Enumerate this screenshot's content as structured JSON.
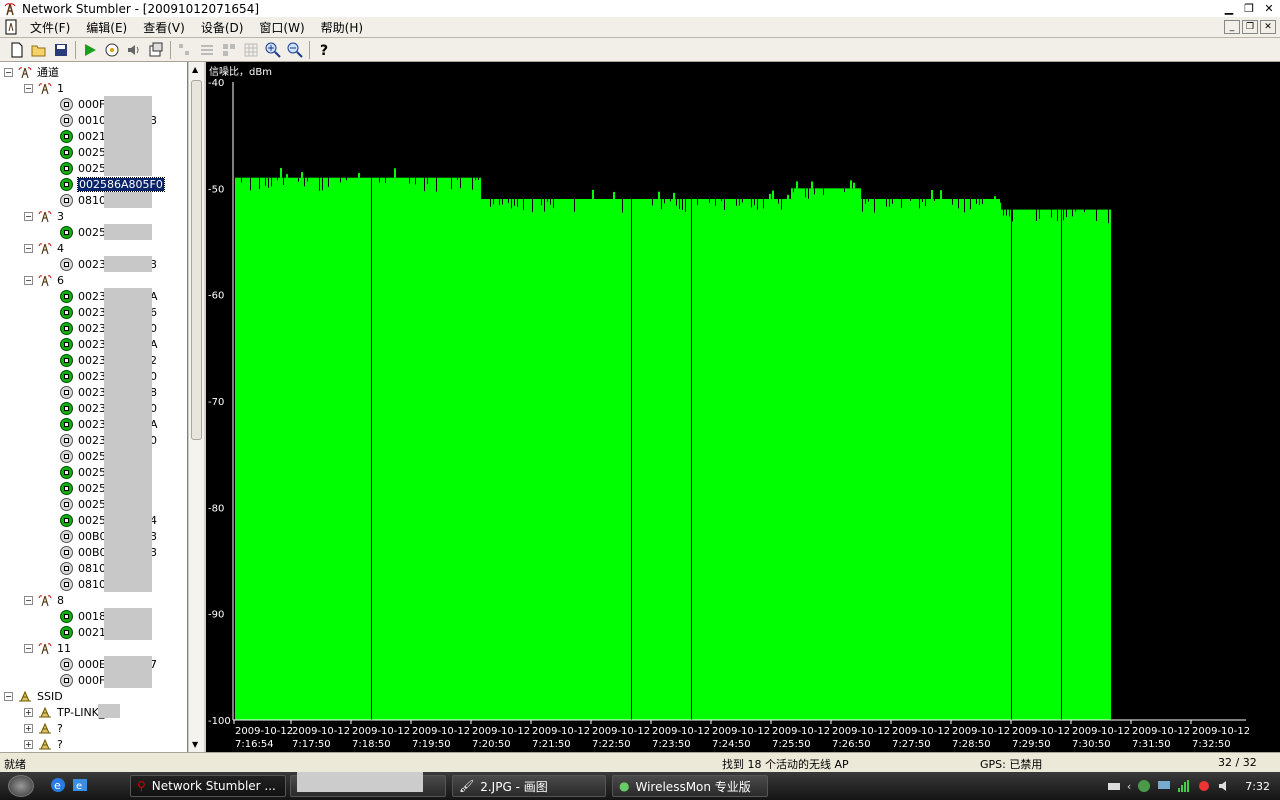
{
  "window": {
    "title": "Network Stumbler - [20091012071654]"
  },
  "menu": [
    "文件(F)",
    "编辑(E)",
    "查看(V)",
    "设备(D)",
    "窗口(W)",
    "帮助(H)"
  ],
  "tree": {
    "channels_label": "通道",
    "channels": [
      {
        "name": "1",
        "aps": [
          {
            "mac": "000F",
            "locked": true
          },
          {
            "mac": "0010",
            "locked": true,
            "suffix": "3"
          },
          {
            "mac": "0021",
            "locked": false
          },
          {
            "mac": "0025",
            "locked": false
          },
          {
            "mac": "0025",
            "locked": false
          },
          {
            "mac": "002586A805F0",
            "locked": false,
            "selected": true
          },
          {
            "mac": "0810",
            "locked": true
          }
        ]
      },
      {
        "name": "3",
        "aps": [
          {
            "mac": "0025",
            "locked": false
          }
        ]
      },
      {
        "name": "4",
        "aps": [
          {
            "mac": "0023",
            "locked": true,
            "suffix": "3"
          }
        ]
      },
      {
        "name": "6",
        "aps": [
          {
            "mac": "0023",
            "locked": false,
            "suffix": "A"
          },
          {
            "mac": "0023",
            "locked": false,
            "suffix": "6"
          },
          {
            "mac": "0023",
            "locked": false,
            "suffix": "0"
          },
          {
            "mac": "0023",
            "locked": false,
            "suffix": "A"
          },
          {
            "mac": "0023",
            "locked": false,
            "suffix": "2"
          },
          {
            "mac": "0023",
            "locked": false,
            "suffix": "0"
          },
          {
            "mac": "0023",
            "locked": true,
            "suffix": "8"
          },
          {
            "mac": "0023",
            "locked": false,
            "suffix": "0"
          },
          {
            "mac": "0023",
            "locked": false,
            "suffix": "A"
          },
          {
            "mac": "0023",
            "locked": true,
            "suffix": "0"
          },
          {
            "mac": "0025",
            "locked": true
          },
          {
            "mac": "0025",
            "locked": false
          },
          {
            "mac": "0025",
            "locked": false
          },
          {
            "mac": "0025",
            "locked": true
          },
          {
            "mac": "0025",
            "locked": false,
            "suffix": "4"
          },
          {
            "mac": "00B0",
            "locked": true,
            "suffix": "3"
          },
          {
            "mac": "00B0",
            "locked": true,
            "suffix": "3"
          },
          {
            "mac": "0810",
            "locked": true
          },
          {
            "mac": "0810",
            "locked": true
          }
        ]
      },
      {
        "name": "8",
        "aps": [
          {
            "mac": "0018",
            "locked": false
          },
          {
            "mac": "0021",
            "locked": false
          }
        ]
      },
      {
        "name": "11",
        "aps": [
          {
            "mac": "000E",
            "locked": true,
            "suffix": "7"
          },
          {
            "mac": "000F",
            "locked": true
          }
        ]
      }
    ],
    "ssid_label": "SSID",
    "ssids": [
      "TP-LINK_",
      "?",
      "?"
    ]
  },
  "chart_data": {
    "type": "bar",
    "title": "信噪比，dBm",
    "ylim": [
      -100,
      -40
    ],
    "yticks": [
      -40,
      -50,
      -60,
      -70,
      -80,
      -90,
      -100
    ],
    "x_ticks": [
      [
        "2009-10-12",
        "7:16:54"
      ],
      [
        "2009-10-12",
        "7:17:50"
      ],
      [
        "2009-10-12",
        "7:18:50"
      ],
      [
        "2009-10-12",
        "7:19:50"
      ],
      [
        "2009-10-12",
        "7:20:50"
      ],
      [
        "2009-10-12",
        "7:21:50"
      ],
      [
        "2009-10-12",
        "7:22:50"
      ],
      [
        "2009-10-12",
        "7:23:50"
      ],
      [
        "2009-10-12",
        "7:24:50"
      ],
      [
        "2009-10-12",
        "7:25:50"
      ],
      [
        "2009-10-12",
        "7:26:50"
      ],
      [
        "2009-10-12",
        "7:27:50"
      ],
      [
        "2009-10-12",
        "7:28:50"
      ],
      [
        "2009-10-12",
        "7:29:50"
      ],
      [
        "2009-10-12",
        "7:30:50"
      ],
      [
        "2009-10-12",
        "7:31:50"
      ],
      [
        "2009-10-12",
        "7:32:50"
      ]
    ],
    "segments": [
      {
        "from": "7:16:54",
        "to": "7:19:00",
        "signal_dbm": -49
      },
      {
        "from": "7:19:00",
        "to": "7:21:00",
        "signal_dbm": -49
      },
      {
        "from": "7:21:00",
        "to": "7:22:50",
        "signal_dbm": -51
      },
      {
        "from": "7:22:50",
        "to": "7:26:10",
        "signal_dbm": -51
      },
      {
        "from": "7:26:10",
        "to": "7:27:20",
        "signal_dbm": -50
      },
      {
        "from": "7:27:20",
        "to": "7:29:40",
        "signal_dbm": -51
      },
      {
        "from": "7:29:40",
        "to": "7:31:30",
        "signal_dbm": -52
      }
    ],
    "gaps": [
      "7:19:10",
      "7:23:30",
      "7:24:30",
      "7:29:50",
      "7:30:40"
    ],
    "color": "#00ff00"
  },
  "status": {
    "ready": "就绪",
    "found": "找到 18 个活动的无线 AP",
    "gps": "GPS: 已禁用",
    "count": "32 / 32"
  },
  "taskbar": {
    "tasks": [
      "Network Stumbler ...",
      "",
      "2.JPG - 画图",
      "WirelessMon 专业版"
    ],
    "clock": "7:32"
  }
}
